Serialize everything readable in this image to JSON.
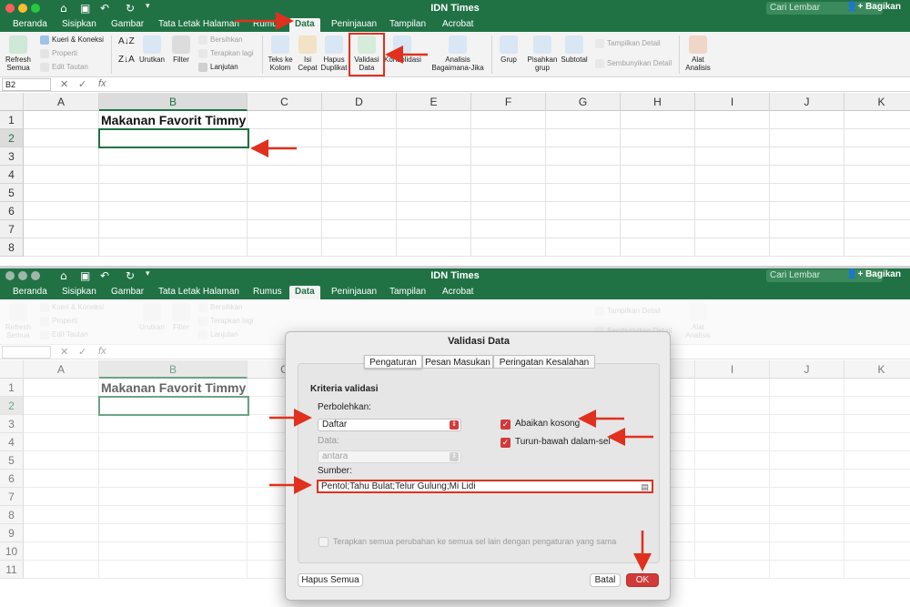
{
  "window": {
    "title": "IDN Times",
    "search_placeholder": "Cari Lembar",
    "share_label": "Bagikan"
  },
  "tabs": [
    "Beranda",
    "Sisipkan",
    "Gambar",
    "Tata Letak Halaman",
    "Rumus",
    "Data",
    "Peninjauan",
    "Tampilan",
    "Acrobat"
  ],
  "active_tab": "Data",
  "ribbon": {
    "refresh": "Refresh\nSemua",
    "queries": "Kueri & Koneksi",
    "properties": "Properti",
    "edit_links": "Edit Tautan",
    "sort": "Urutkan",
    "filter": "Filter",
    "clear": "Bersihkan",
    "reapply": "Terapkan lagi",
    "advanced": "Lanjutan",
    "text_to_columns": "Teks ke\nKolom",
    "flash_fill": "Isi\nCepat",
    "remove_duplicates": "Hapus\nDuplikat",
    "data_validation": "Validasi\nData",
    "consolidate": "Konsolidasi",
    "what_if": "Analisis\nBagaimana-Jika",
    "group": "Grup",
    "ungroup": "Pisahkan\ngrup",
    "subtotal": "Subtotal",
    "show_detail": "Tampilkan Detail",
    "hide_detail": "Sembunyikan Detail",
    "analysis_tools": "Alat\nAnalisis"
  },
  "formula_bar": {
    "name_box_top": "B2",
    "name_box_bottom": "",
    "fx": "fx"
  },
  "sheet": {
    "columns": [
      "A",
      "B",
      "C",
      "D",
      "E",
      "F",
      "G",
      "H",
      "I",
      "J",
      "K"
    ],
    "rows_top": [
      "1",
      "2",
      "3",
      "4",
      "5",
      "6",
      "7",
      "8"
    ],
    "rows_bottom": [
      "1",
      "2",
      "3",
      "4",
      "5",
      "6",
      "7",
      "8",
      "9",
      "10",
      "11"
    ],
    "b1_value": "Makanan Favorit Timmy"
  },
  "dialog": {
    "title": "Validasi Data",
    "tabs": [
      "Pengaturan",
      "Pesan Masukan",
      "Peringatan Kesalahan"
    ],
    "active_tab": "Pengaturan",
    "criteria_heading": "Kriteria validasi",
    "allow_label": "Perbolehkan:",
    "allow_value": "Daftar",
    "data_label": "Data:",
    "data_value": "antara",
    "ignore_blank_label": "Abaikan kosong",
    "ignore_blank_checked": true,
    "in_cell_dropdown_label": "Turun-bawah dalam-sel",
    "in_cell_dropdown_checked": true,
    "source_label": "Sumber:",
    "source_value": "Pentol;Tahu Bulat;Telur Gulung;Mi Lidi",
    "apply_all_label": "Terapkan semua perubahan ke semua sel lain dengan pengaturan yang sama",
    "apply_all_checked": false,
    "clear_all_button": "Hapus Semua",
    "cancel_button": "Batal",
    "ok_button": "OK"
  },
  "colors": {
    "excel_green": "#207245",
    "highlight_red": "#e0301e",
    "ok_red": "#d23a3a"
  }
}
